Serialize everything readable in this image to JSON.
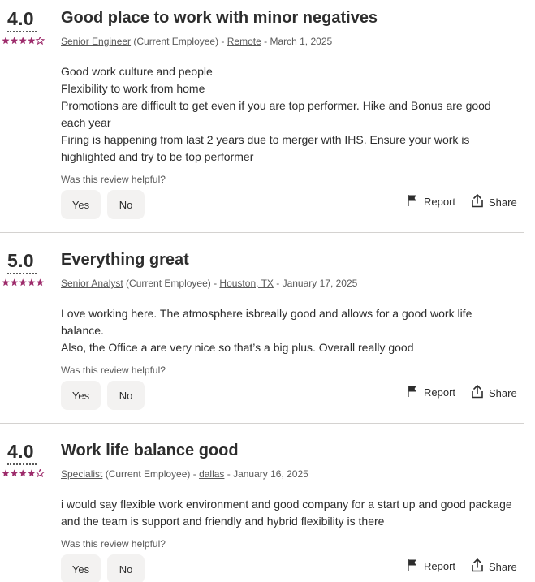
{
  "colors": {
    "star": "#9d2b6b",
    "star_empty": "#9d2b6b",
    "text": "#2d2d2d",
    "muted": "#595959",
    "button_bg": "#f3f2f1",
    "divider": "#d4d2d0"
  },
  "helpful_prompt": "Was this review helpful?",
  "yes_label": "Yes",
  "no_label": "No",
  "report_label": "Report",
  "share_label": "Share",
  "icons": {
    "report": "flag-icon",
    "share": "share-icon",
    "star": "star-icon"
  },
  "reviews": [
    {
      "rating": "4.0",
      "stars": 4,
      "title": "Good place to work with minor negatives",
      "job_title": "Senior Engineer",
      "status": " (Current Employee) - ",
      "location": "Remote",
      "date": " - March 1, 2025",
      "body": [
        "Good work culture and people",
        "Flexibility to work from home",
        "Promotions are difficult to get even if you are top performer. Hike and Bonus are good each year",
        "Firing is happening from last 2 years due to merger with IHS. Ensure your work is highlighted and try to be top performer"
      ]
    },
    {
      "rating": "5.0",
      "stars": 5,
      "title": "Everything great",
      "job_title": "Senior Analyst",
      "status": " (Current Employee) - ",
      "location": "Houston, TX",
      "date": " - January 17, 2025",
      "body": [
        "Love working here. The atmosphere isbreally good and allows for a good work life balance.",
        "Also, the Office a are very nice so that’s a big plus. Overall really good"
      ]
    },
    {
      "rating": "4.0",
      "stars": 4,
      "title": "Work life balance good",
      "job_title": "Specialist",
      "status": " (Current Employee) - ",
      "location": "dallas",
      "date": " - January 16, 2025",
      "body": [
        "i would say flexible work environment and good company for a start up and good package and the team is support and friendly and hybrid flexibility is there"
      ]
    }
  ]
}
